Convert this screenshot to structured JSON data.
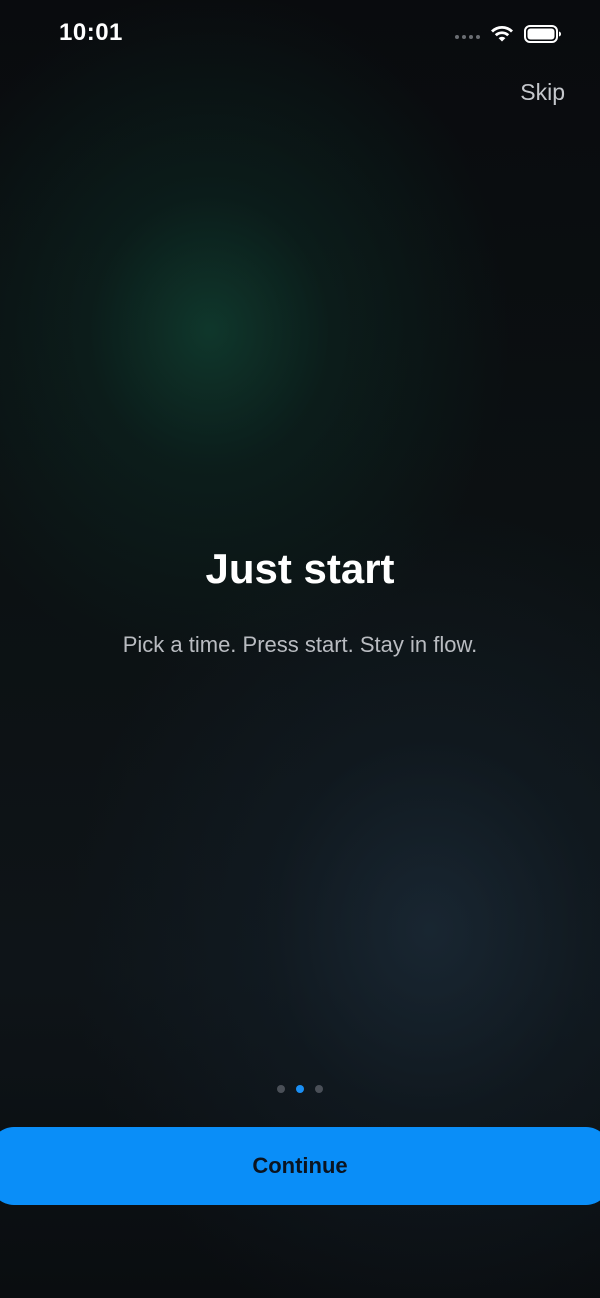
{
  "status_bar": {
    "time": "10:01",
    "icons": [
      "signal-dots-icon",
      "wifi-icon",
      "battery-icon"
    ]
  },
  "header": {
    "skip_label": "Skip"
  },
  "onboarding": {
    "title": "Just start",
    "subtitle": "Pick a time. Press start. Stay in flow.",
    "page_count": 3,
    "current_page": 2
  },
  "footer": {
    "continue_label": "Continue"
  },
  "colors": {
    "accent": "#0a8ef8",
    "active_dot": "#1a8ff4",
    "inactive_dot": "#4a4f57",
    "button_text": "#0b1420"
  }
}
